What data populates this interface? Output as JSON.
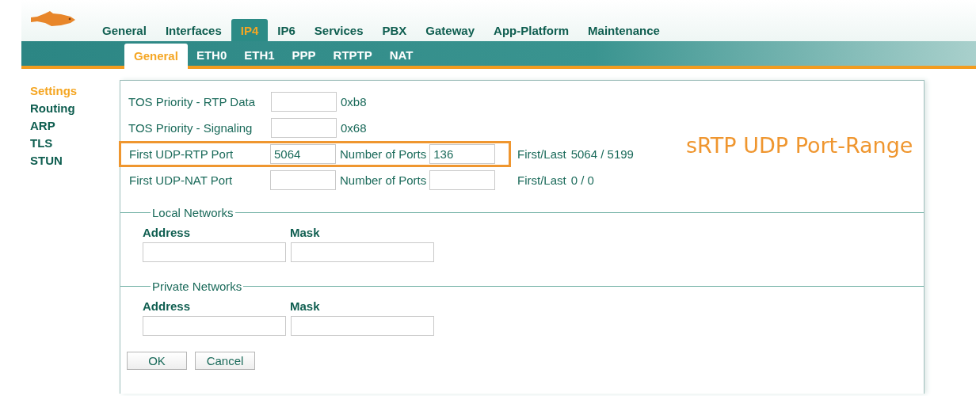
{
  "top_tabs": [
    {
      "label": "General",
      "selected": false
    },
    {
      "label": "Interfaces",
      "selected": false
    },
    {
      "label": "IP4",
      "selected": true
    },
    {
      "label": "IP6",
      "selected": false
    },
    {
      "label": "Services",
      "selected": false
    },
    {
      "label": "PBX",
      "selected": false
    },
    {
      "label": "Gateway",
      "selected": false
    },
    {
      "label": "App-Platform",
      "selected": false
    },
    {
      "label": "Maintenance",
      "selected": false
    }
  ],
  "sub_tabs": [
    {
      "label": "General",
      "selected": true
    },
    {
      "label": "ETH0",
      "selected": false
    },
    {
      "label": "ETH1",
      "selected": false
    },
    {
      "label": "PPP",
      "selected": false
    },
    {
      "label": "RTPTP",
      "selected": false
    },
    {
      "label": "NAT",
      "selected": false
    }
  ],
  "sidebar": {
    "items": [
      {
        "label": "Settings",
        "selected": true
      },
      {
        "label": "Routing",
        "selected": false
      },
      {
        "label": "ARP",
        "selected": false
      },
      {
        "label": "TLS",
        "selected": false
      },
      {
        "label": "STUN",
        "selected": false
      }
    ]
  },
  "form": {
    "rows": [
      {
        "kind": "tos",
        "label": "TOS Priority - RTP Data",
        "hint": "0xb8"
      },
      {
        "kind": "tos",
        "label": "TOS Priority - Signaling",
        "hint": "0x68"
      },
      {
        "kind": "ports",
        "label": "First UDP-RTP Port",
        "value": "5064",
        "count_label": "Number of Ports",
        "count_value": "136",
        "range_label": "First/Last",
        "range_value": "5064 / 5199",
        "highlighted": true
      },
      {
        "kind": "ports",
        "label": "First UDP-NAT Port",
        "count_label": "Number of Ports",
        "range_label": "First/Last",
        "range_value": "0 / 0",
        "highlighted": false
      }
    ],
    "groups": [
      {
        "legend": "Local Networks",
        "address_label": "Address",
        "mask_label": "Mask"
      },
      {
        "legend": "Private Networks",
        "address_label": "Address",
        "mask_label": "Mask"
      }
    ],
    "buttons": [
      "OK",
      "Cancel"
    ]
  },
  "annotation": {
    "text": "sRTP UDP Port-Range"
  }
}
